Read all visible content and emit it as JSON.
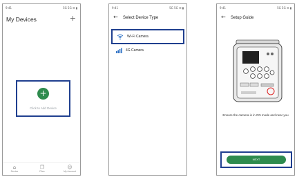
{
  "screens": [
    {
      "status": {
        "time": "9:41",
        "icons": "5G 5G ☰ ▮"
      },
      "title": "My Devices",
      "add_icon": "+",
      "add_device": {
        "icon": "+",
        "label": "Click to Add Device"
      },
      "bottom_nav": [
        {
          "icon": "⌂",
          "label": "Device"
        },
        {
          "icon": "❐",
          "label": "Files"
        },
        {
          "icon": "☺",
          "label": "My Account"
        }
      ]
    },
    {
      "status": {
        "time": "9:41",
        "icons": "5G 5G ☰ ▮"
      },
      "back_icon": "←",
      "title": "Select Device Type",
      "device_types": [
        {
          "label": "Wi-Fi Camera"
        },
        {
          "label": "4G Camera"
        }
      ]
    },
    {
      "status": {
        "time": "9:41",
        "icons": "5G 5G ☰ ▮"
      },
      "back_icon": "←",
      "title": "Setup Guide",
      "instruction": "Ensure the camera is in ON mode and near you",
      "next_label": "NEXT"
    }
  ],
  "colors": {
    "accent_green": "#2e8b4e",
    "highlight_blue": "#1f3f8f"
  }
}
